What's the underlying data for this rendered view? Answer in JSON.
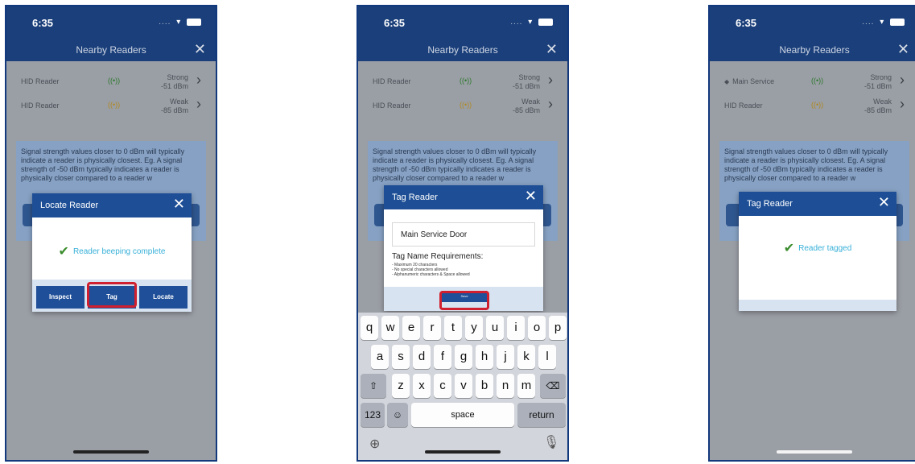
{
  "status_bar": {
    "time": "6:35",
    "signal": "...."
  },
  "nav": {
    "title": "Nearby Readers",
    "close": "✕"
  },
  "readers": [
    {
      "name": "HID Reader",
      "strength": "Strong",
      "dbm": "-51 dBm"
    },
    {
      "name": "HID Reader",
      "strength": "Weak",
      "dbm": "-85 dBm"
    }
  ],
  "readers_after": [
    {
      "name": "Main Service",
      "strength": "Strong",
      "dbm": "-51 dBm"
    },
    {
      "name": "HID Reader",
      "strength": "Weak",
      "dbm": "-85 dBm"
    }
  ],
  "info_text": "Signal strength values closer to 0 dBm will typically indicate a reader is physically closest. Eg. A signal strength of -50 dBm typically indicates a reader is physically closer compared to a reader w",
  "locate_modal": {
    "title": "Locate Reader",
    "close": "✕",
    "message": "Reader beeping complete",
    "buttons": {
      "inspect": "Inspect",
      "tag": "Tag",
      "locate": "Locate"
    }
  },
  "tag_modal": {
    "title": "Tag Reader",
    "close": "✕",
    "input_value": "Main Service Door",
    "requirements_title": "Tag Name Requirements:",
    "requirements": [
      "- Maximum 20 characters",
      "- No special characters allowed",
      "- Alphanumeric characters & Space allowed"
    ],
    "save": "Save"
  },
  "keyboard": {
    "row1": [
      "q",
      "w",
      "e",
      "r",
      "t",
      "y",
      "u",
      "i",
      "o",
      "p"
    ],
    "row2": [
      "a",
      "s",
      "d",
      "f",
      "g",
      "h",
      "j",
      "k",
      "l"
    ],
    "row3": [
      "z",
      "x",
      "c",
      "v",
      "b",
      "n",
      "m"
    ],
    "numbers": "123",
    "space": "space",
    "return": "return"
  },
  "tagged_modal": {
    "title": "Tag Reader",
    "close": "✕",
    "message": "Reader tagged"
  },
  "colors": {
    "navy": "#1a3f7a",
    "modal_header": "#1e4f96",
    "highlight": "#d01f2e",
    "success": "#37b0d8"
  }
}
